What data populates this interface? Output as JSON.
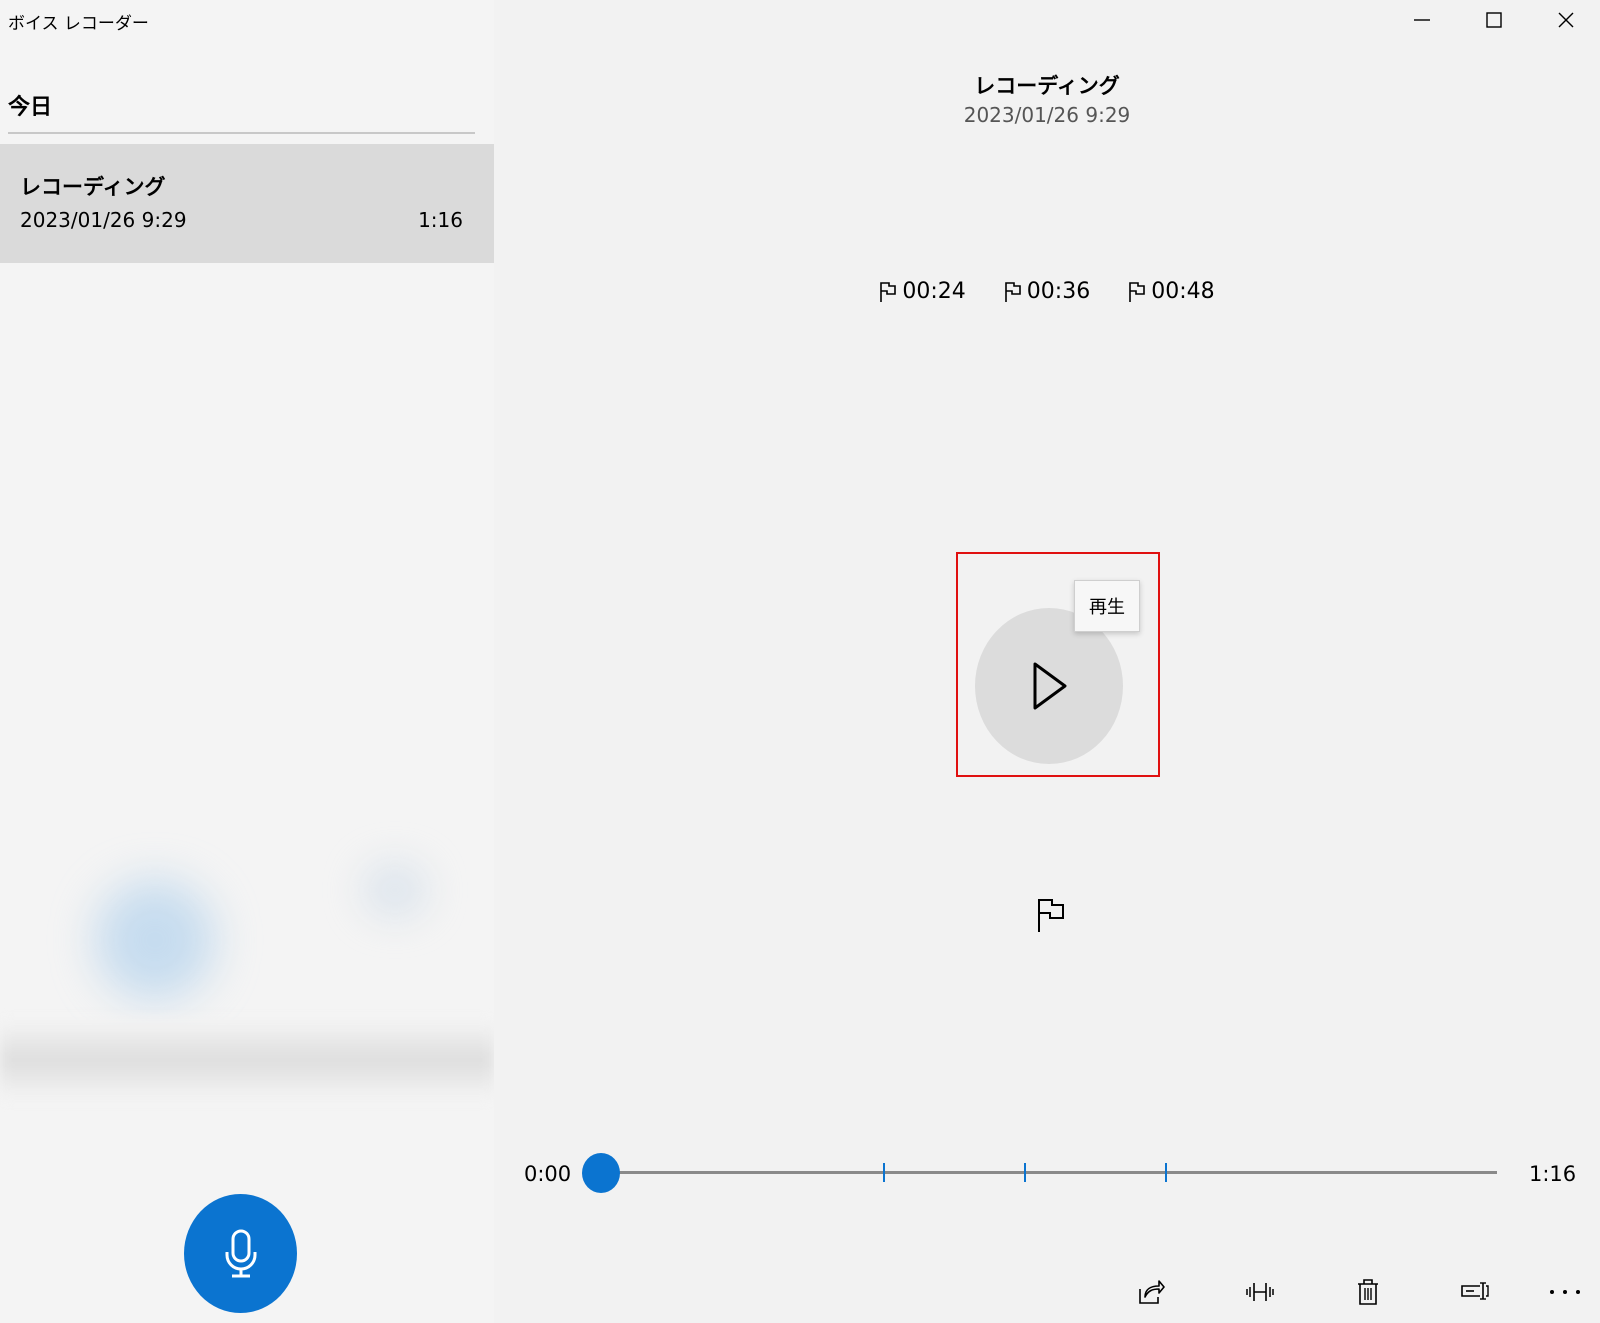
{
  "window": {
    "title": "ボイス レコーダー",
    "minimize_icon": "minimize-icon",
    "maximize_icon": "maximize-icon",
    "close_icon": "close-icon"
  },
  "sidebar": {
    "section_heading": "今日",
    "items": [
      {
        "name": "レコーディング",
        "date": "2023/01/26 9:29",
        "duration": "1:16",
        "selected": true
      }
    ],
    "record_button_icon": "microphone-icon",
    "accent_color": "#0b74d0"
  },
  "main": {
    "title": "レコーディング",
    "date": "2023/01/26 9:29",
    "markers": [
      {
        "label": "00:24",
        "icon": "flag-icon"
      },
      {
        "label": "00:36",
        "icon": "flag-icon"
      },
      {
        "label": "00:48",
        "icon": "flag-icon"
      }
    ],
    "play_button": {
      "icon": "play-icon",
      "tooltip": "再生"
    },
    "add_marker_icon": "flag-icon",
    "timeline": {
      "current_time": "0:00",
      "total_time": "1:16",
      "position_fraction": 0,
      "marker_seconds": [
        24,
        36,
        48
      ],
      "total_seconds": 76
    },
    "toolbar": [
      {
        "icon": "share-icon"
      },
      {
        "icon": "trim-icon"
      },
      {
        "icon": "delete-icon"
      },
      {
        "icon": "rename-icon"
      },
      {
        "icon": "more-icon"
      }
    ]
  }
}
